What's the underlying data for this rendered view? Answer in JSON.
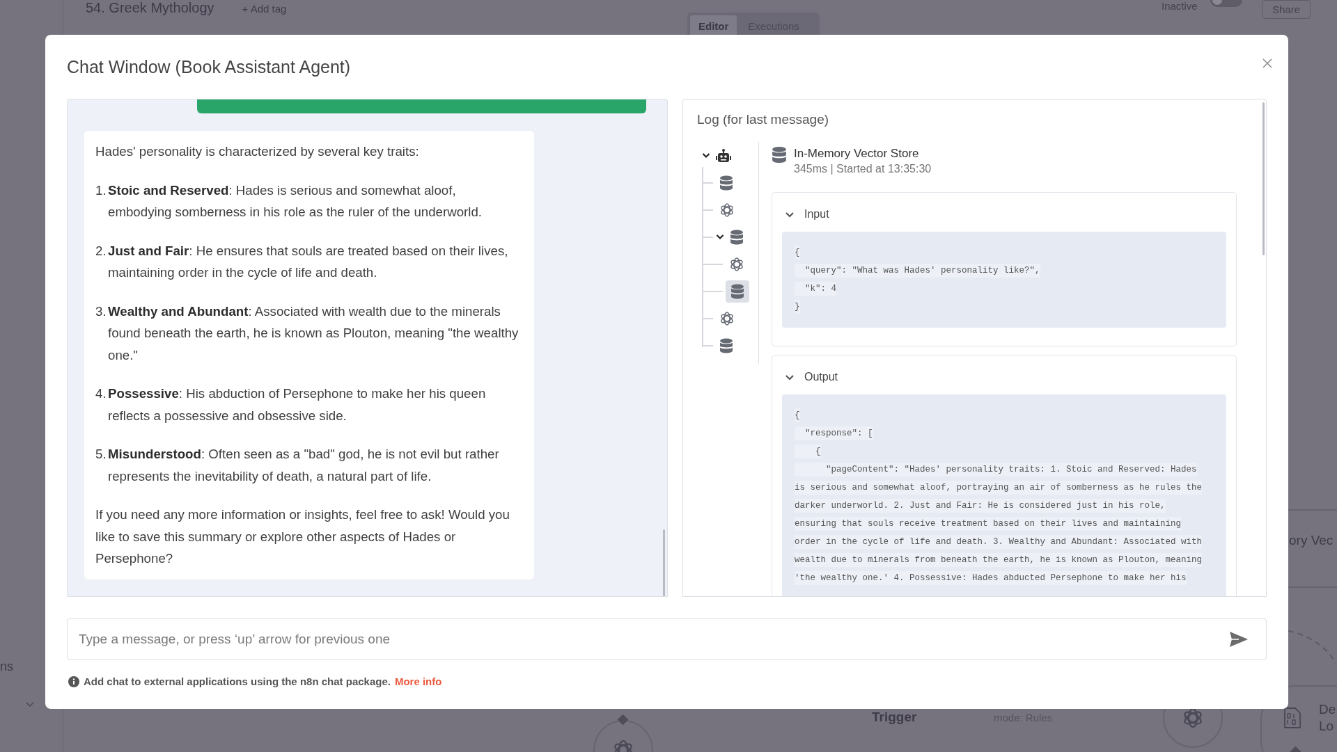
{
  "background": {
    "workflow_title": "54. Greek Mythology",
    "add_tag": "+ Add tag",
    "tabs": [
      {
        "label": "Editor",
        "selected": true
      },
      {
        "label": "Executions",
        "selected": false
      }
    ],
    "activation": {
      "label": "Inactive",
      "on": false
    },
    "share": "Share",
    "sidebar_text": "ns",
    "node_label": "ory Vec",
    "trigger_label": "Trigger",
    "trigger_mode": "mode: Rules",
    "loader_label": [
      "De",
      "Lo"
    ]
  },
  "modal": {
    "title": "Chat Window (Book Assistant Agent)",
    "message": {
      "intro": "Hades' personality is characterized by several key traits:",
      "items": [
        {
          "number": "1.",
          "text": "**Stoic and Reserved**: Hades is serious and somewhat aloof, embodying somberness in his role as the ruler of the underworld."
        },
        {
          "number": "2.",
          "text": "**Just and Fair**: He ensures that souls are treated based on their lives, maintaining order in the cycle of life and death."
        },
        {
          "number": "3.",
          "text": "**Wealthy and Abundant**: Associated with wealth due to the minerals found beneath the earth, he is known as Plouton, meaning \"the wealthy one.\""
        },
        {
          "number": "4.",
          "text": "**Possessive**: His abduction of Persephone to make her his queen reflects a possessive and obsessive side."
        },
        {
          "number": "5.",
          "text": "**Misunderstood**: Often seen as a \"bad\" god, he is not evil but rather represents the inevitability of death, a natural part of life."
        }
      ],
      "outro": "If you need any more information or insights, feel free to ask! Would you like to save this summary or explore other aspects of Hades or Persephone?"
    },
    "log": {
      "title": "Log (for last message)",
      "tree": [
        {
          "kind": "agent",
          "expanded": true,
          "selected": false,
          "children": [
            {
              "kind": "vector-store",
              "selected": false
            },
            {
              "kind": "model",
              "selected": false
            },
            {
              "kind": "vector-store",
              "expanded": true,
              "selected": false,
              "children": [
                {
                  "kind": "model",
                  "selected": false
                },
                {
                  "kind": "vector-store",
                  "selected": true
                }
              ]
            },
            {
              "kind": "model",
              "selected": false
            },
            {
              "kind": "vector-store",
              "selected": false
            }
          ]
        }
      ],
      "details": {
        "name": "In-Memory Vector Store",
        "meta": "345ms | Started at 13:35:30",
        "sections": [
          {
            "title": "Input",
            "expanded": true,
            "lines": [
              "{",
              "  \"query\": \"What was Hades' personality like?\",",
              "  \"k\": 4",
              "}"
            ]
          },
          {
            "title": "Output",
            "expanded": true,
            "lines": [
              "{",
              "  \"response\": [",
              "    {",
              "      \"pageContent\": \"Hades' personality traits: 1. Stoic and Reserved: Hades",
              "is serious and somewhat aloof, portraying an air of somberness as he rules the",
              "darker underworld. 2. Just and Fair: He is considered just in his role,",
              "ensuring that souls receive treatment based on their lives and maintaining",
              "order in the cycle of life and death. 3. Wealthy and Abundant: Associated with",
              "wealth due to minerals from beneath the earth, he is known as Plouton, meaning",
              "'the wealthy one.' 4. Possessive: Hades abducted Persephone to make her his"
            ]
          }
        ]
      }
    },
    "input": {
      "placeholder": "Type a message, or press ‘up’ arrow for previous one"
    },
    "footer": {
      "text": "Add chat to external applications using the n8n chat package.",
      "link": "More info"
    }
  }
}
